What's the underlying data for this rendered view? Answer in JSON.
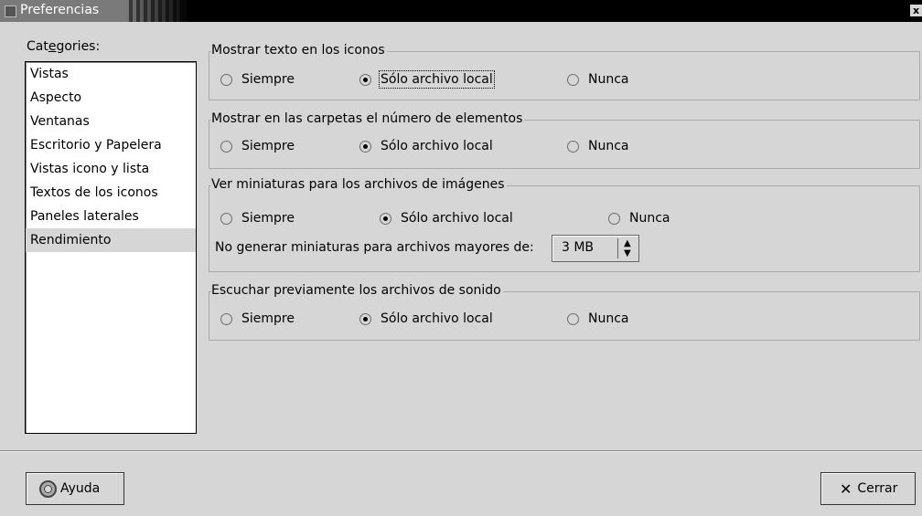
{
  "window": {
    "title": "Preferencias",
    "close_glyph": "x"
  },
  "categories": {
    "label_prefix": "Cat",
    "label_mnemonic": "e",
    "label_suffix": "gories:",
    "items": [
      {
        "label": "Vistas"
      },
      {
        "label": "Aspecto"
      },
      {
        "label": "Ventanas"
      },
      {
        "label": "Escritorio y Papelera"
      },
      {
        "label": "Vistas icono y lista"
      },
      {
        "label": "Textos de los iconos"
      },
      {
        "label": "Paneles laterales"
      },
      {
        "label": "Rendimiento",
        "selected": true
      }
    ]
  },
  "sections": {
    "icon_text": {
      "title": "Mostrar texto en los iconos",
      "options": [
        "Siempre",
        "Sólo archivo local",
        "Nunca"
      ],
      "selected": "Sólo archivo local"
    },
    "item_count": {
      "title": "Mostrar en las carpetas el número de elementos",
      "options": [
        "Siempre",
        "Sólo archivo local",
        "Nunca"
      ],
      "selected": "Sólo archivo local"
    },
    "thumbnails": {
      "title": "Ver miniaturas para los archivos de imágenes",
      "options": [
        "Siempre",
        "Sólo archivo local",
        "Nunca"
      ],
      "selected": "Sólo archivo local",
      "max_size_label": "No generar miniaturas para archivos mayores de:",
      "max_size_value": "3 MB"
    },
    "sound_preview": {
      "title": "Escuchar previamente los archivos de sonido",
      "options": [
        "Siempre",
        "Sólo archivo local",
        "Nunca"
      ],
      "selected": "Sólo archivo local"
    }
  },
  "buttons": {
    "help": "Ayuda",
    "close": "Cerrar"
  }
}
